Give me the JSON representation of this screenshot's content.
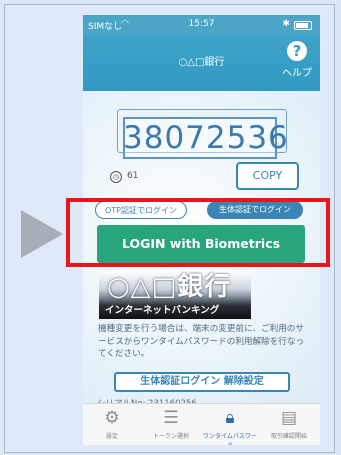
{
  "status_bar": {
    "carrier": "SIMなし",
    "time": "15:57",
    "wifi_icon": "wifi-icon",
    "bluetooth_icon": "bluetooth-icon"
  },
  "header": {
    "title": "○△□銀行",
    "help_label": "ヘルプ",
    "help_icon": "?"
  },
  "token": {
    "code": "38072536",
    "timer_value": "61",
    "copy_label": "COPY"
  },
  "mode_tabs": {
    "otp_label": "OTP認証でログイン",
    "biometric_label": "生体認証でログイン"
  },
  "login_button_label": "LOGIN with Biometrics",
  "banner": {
    "mark": "○△□銀行",
    "subtitle": "インターネットバンキング"
  },
  "note": "機種変更を行う場合は、端末の変更前に、ご利用のサービスからワンタイムパスワードの利用解除を行なってください。",
  "disable_button_label": "生体認証ログイン 解除設定",
  "serial": "シリアルNo: 231160256",
  "tab_bar": {
    "items": [
      {
        "label": "設定",
        "icon": "gear-icon"
      },
      {
        "label": "トークン選択",
        "icon": "list-icon"
      },
      {
        "label": "ワンタイムパスワード",
        "icon": "lock-icon"
      },
      {
        "label": "取引確認開始",
        "icon": "document-icon"
      }
    ]
  },
  "colors": {
    "header": "#3fa2c8",
    "primary": "#3b85b5",
    "login_button": "#28a57c",
    "highlight": "#e8151b"
  }
}
